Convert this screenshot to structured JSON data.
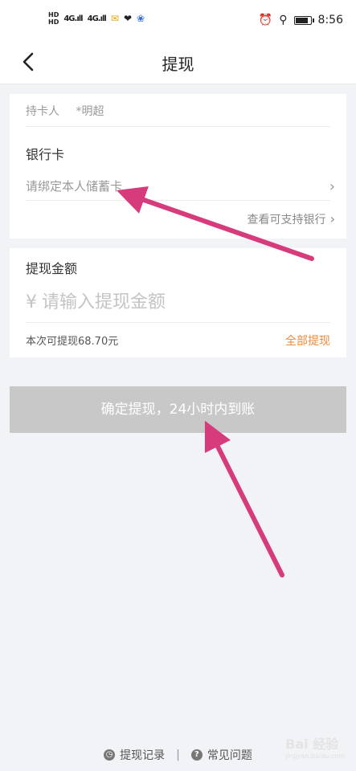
{
  "status_bar": {
    "time": "8:56",
    "network": "4G",
    "battery_level": 0.9,
    "icons": [
      "hd-icon",
      "signal-icon",
      "mail-icon",
      "heart-icon",
      "paw-icon",
      "alarm-icon",
      "location-icon",
      "battery-icon"
    ]
  },
  "nav": {
    "title": "提现",
    "back_icon": "back-chevron-icon"
  },
  "card_holder": {
    "label": "持卡人",
    "name": "*明超"
  },
  "bank": {
    "title": "银行卡",
    "bind_prompt": "请绑定本人储蓄卡",
    "support_link": "查看可支持银行"
  },
  "amount": {
    "title": "提现金额",
    "currency": "¥",
    "placeholder": "请输入提现金额",
    "available": "本次可提现68.70元",
    "all_label": "全部提现"
  },
  "confirm": {
    "label": "确定提现，24小时内到账",
    "color": "#c8c8c8"
  },
  "footer": {
    "records": "提现记录",
    "faq": "常见问题",
    "separator": "|"
  },
  "watermark": {
    "brand": "Bai 经验",
    "sub": "jingyan.baidu.com"
  },
  "colors": {
    "accent_orange": "#ee8a3a",
    "annotation_pink": "#d63b7c",
    "background": "#f2f3f7"
  }
}
